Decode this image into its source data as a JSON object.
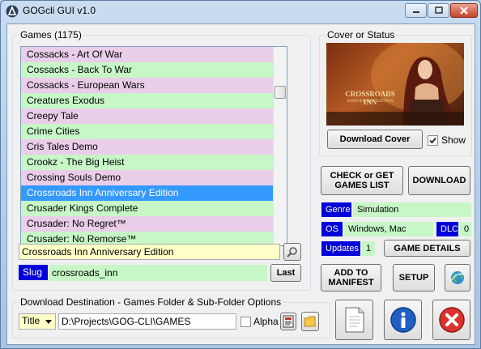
{
  "window": {
    "title": "GOGcli GUI v1.0"
  },
  "games": {
    "group_title": "Games  (1175)",
    "items": [
      {
        "label": "Cossacks - Art Of War",
        "color": "#eacde9"
      },
      {
        "label": "Cossacks - Back To War",
        "color": "#c7f7c7"
      },
      {
        "label": "Cossacks - European Wars",
        "color": "#eacde9"
      },
      {
        "label": "Creatures Exodus",
        "color": "#c7f7c7"
      },
      {
        "label": "Creepy Tale",
        "color": "#eacde9"
      },
      {
        "label": "Crime Cities",
        "color": "#c7f7c7"
      },
      {
        "label": "Cris Tales Demo",
        "color": "#eacde9"
      },
      {
        "label": "Crookz - The Big Heist",
        "color": "#c7f7c7"
      },
      {
        "label": "Crossing Souls Demo",
        "color": "#eacde9"
      },
      {
        "label": "Crossroads Inn Anniversary Edition",
        "color": "#3399ff",
        "selected": true
      },
      {
        "label": "Crusader Kings Complete",
        "color": "#c7f7c7"
      },
      {
        "label": "Crusader: No Regret™",
        "color": "#eacde9"
      },
      {
        "label": "Crusader: No Remorse™",
        "color": "#c7f7c7"
      }
    ],
    "title_field_value": "Crossroads Inn Anniversary Edition",
    "slug_label": "Slug",
    "slug_value": "crossroads_inn",
    "last_button": "Last"
  },
  "cover": {
    "group_title": "Cover or Status",
    "download_cover_button": "Download Cover",
    "show_label": "Show",
    "show_checked": true,
    "logo_line1": "CROSSROADS INN",
    "logo_line2": "ANNIVERSARY EDITION"
  },
  "actions": {
    "check_get_button": "CHECK or GET GAMES LIST",
    "download_button": "DOWNLOAD",
    "add_manifest_button": "ADD TO MANIFEST",
    "setup_button": "SETUP",
    "game_details_button": "GAME DETAILS"
  },
  "info": {
    "genre_label": "Genre",
    "genre_value": "Simulation",
    "os_label": "OS",
    "os_value": "Windows, Mac",
    "dlc_label": "DLC",
    "dlc_value": "0",
    "updates_label": "Updates",
    "updates_value": "1"
  },
  "destination": {
    "group_title": "Download Destination - Games Folder & Sub-Folder Options",
    "combo_value": "Title",
    "path_value": "D:\\Projects\\GOG-CLI\\GAMES",
    "alpha_label": "Alpha",
    "alpha_checked": false
  }
}
